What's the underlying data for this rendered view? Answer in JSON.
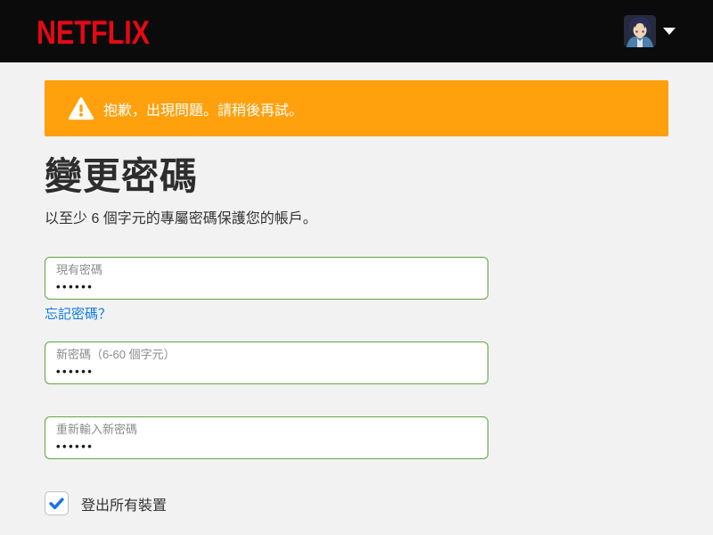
{
  "header": {
    "brand": "NETFLIX"
  },
  "alert": {
    "message": "抱歉，出現問題。請稍後再試。"
  },
  "page": {
    "title": "變更密碼",
    "subtitle": "以至少 6 個字元的專屬密碼保護您的帳戶。"
  },
  "form": {
    "current_password": {
      "label": "現有密碼",
      "value": "••••••"
    },
    "forgot_link": "忘記密碼？",
    "new_password": {
      "label": "新密碼（6-60 個字元）",
      "value": "••••••"
    },
    "confirm_password": {
      "label": "重新輸入新密碼",
      "value": "••••••"
    },
    "signout_all_devices": {
      "label": "登出所有裝置",
      "checked": true
    }
  },
  "icons": {
    "warning": "warning-triangle-icon",
    "caret": "caret-down-icon",
    "avatar": "profile-avatar",
    "check": "check-icon"
  },
  "colors": {
    "brand_red": "#e50914",
    "header_black": "#0b0b0b",
    "page_bg": "#f2f2f2",
    "alert_orange": "#ffa00c",
    "field_border_green": "#5fa53f",
    "link_blue": "#0d7be3",
    "check_blue": "#1a73e8"
  }
}
